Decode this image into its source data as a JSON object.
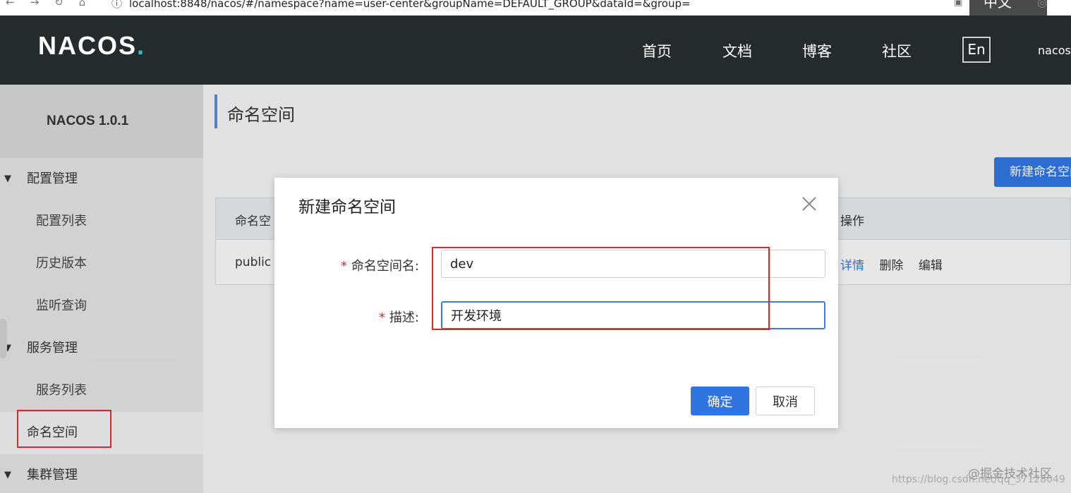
{
  "browser": {
    "url": "localhost:8848/nacos/#/namespace?name=user-center&groupName=DEFAULT_GROUP&dataId=&group=",
    "lang_chip": "中文"
  },
  "header": {
    "logo": "NACOS",
    "logo_dot": ".",
    "nav": [
      "首页",
      "文档",
      "博客",
      "社区"
    ],
    "lang_button": "En",
    "user": "nacos"
  },
  "sidebar": {
    "version": "NACOS 1.0.1",
    "groups": [
      {
        "label": "配置管理",
        "items": [
          "配置列表",
          "历史版本",
          "监听查询"
        ]
      },
      {
        "label": "服务管理",
        "items": [
          "服务列表"
        ]
      },
      {
        "label": "命名空间",
        "items": []
      },
      {
        "label": "集群管理",
        "items": []
      }
    ],
    "active": "命名空间"
  },
  "main": {
    "title": "命名空间",
    "new_button": "新建命名空间",
    "table": {
      "headers": [
        "命名空",
        "操作"
      ],
      "rows": [
        {
          "name": "public",
          "ops": [
            "详情",
            "删除",
            "编辑"
          ]
        }
      ]
    }
  },
  "dialog": {
    "title": "新建命名空间",
    "fields": [
      {
        "required_mark": "*",
        "label": "命名空间名:",
        "value": "dev"
      },
      {
        "required_mark": "*",
        "label": "描述:",
        "value": "开发环境"
      }
    ],
    "ok_label": "确定",
    "cancel_label": "取消"
  },
  "watermark": {
    "line1": "@掘金技术社区",
    "line2": "https://blog.csdn.net/qq_37128049"
  },
  "colors": {
    "primary": "#2f74e0",
    "header_bg": "#252a2c",
    "highlight_red": "#e0252b"
  }
}
